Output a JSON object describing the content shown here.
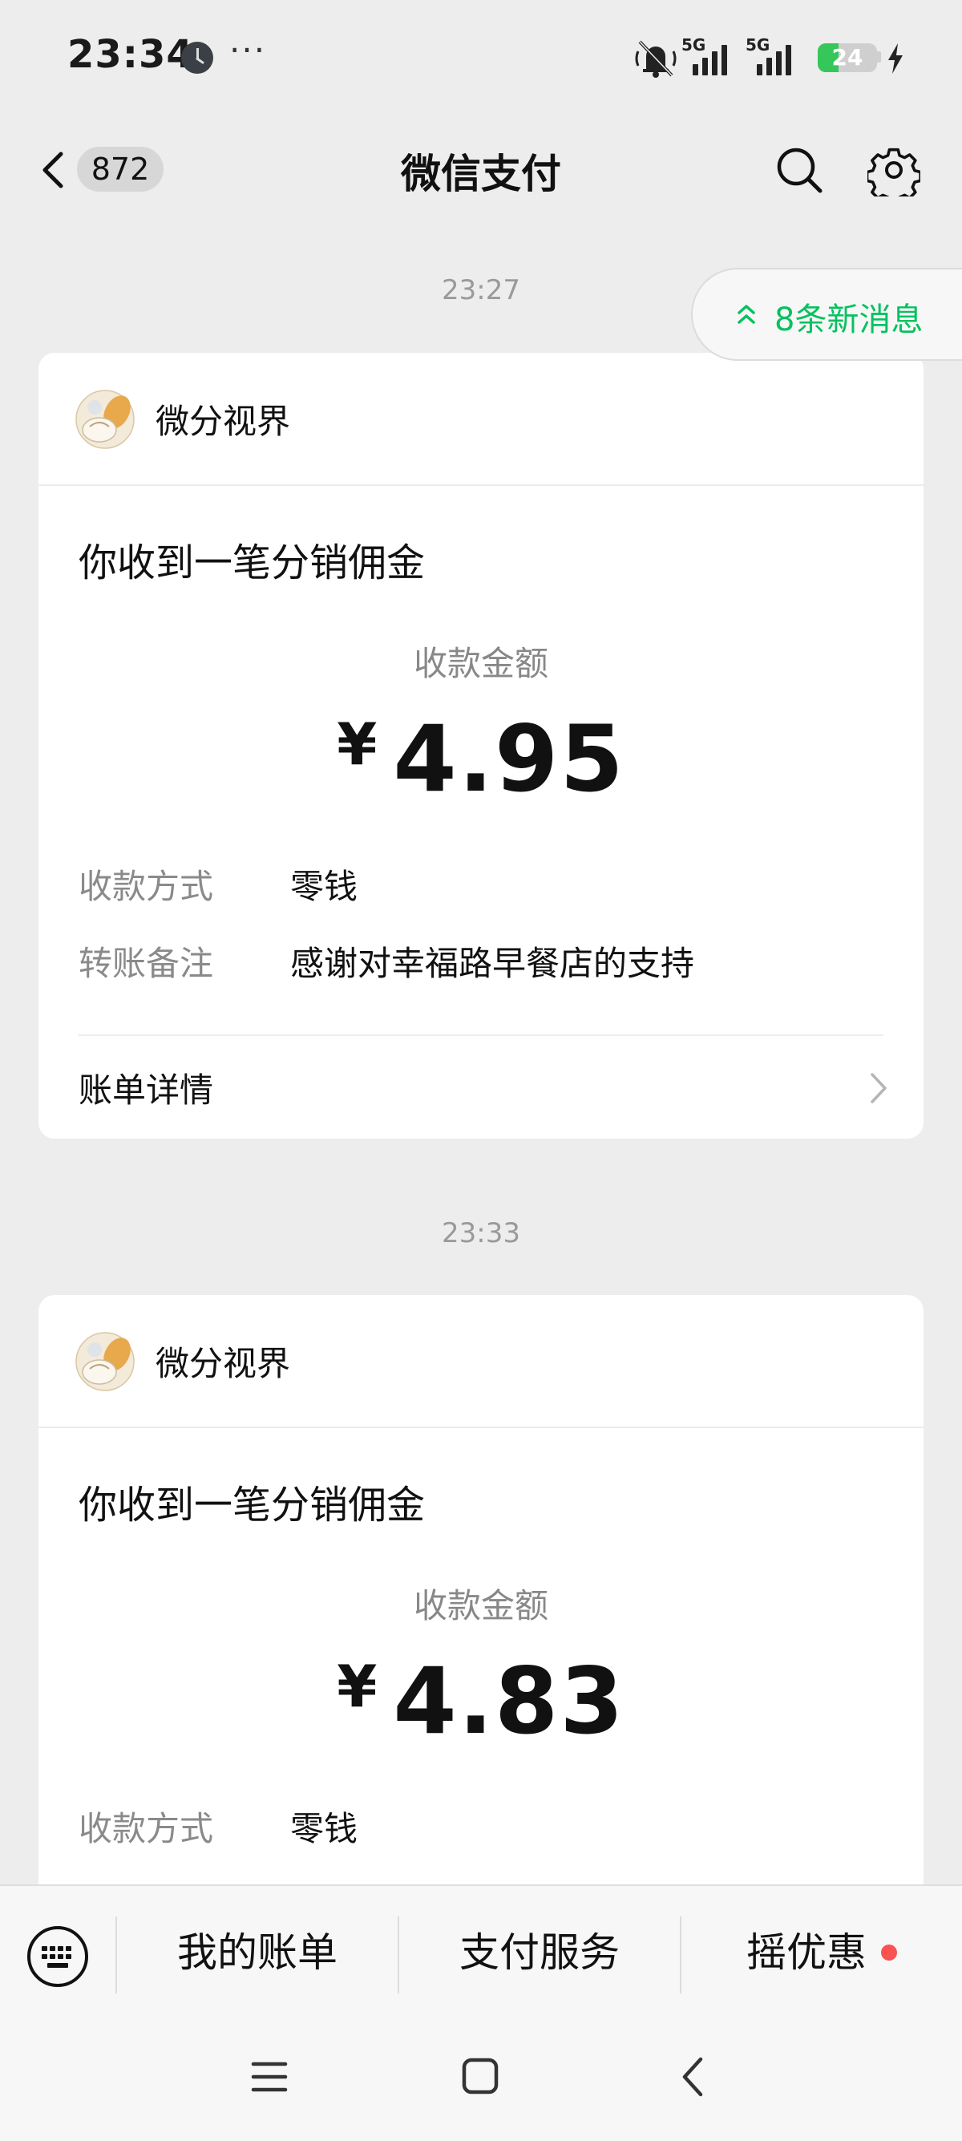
{
  "status_bar": {
    "time": "23:34",
    "more": "···",
    "network_1": "5G",
    "network_2": "5G",
    "battery_level": "24",
    "battery_fraction": 0.24,
    "icons": [
      "clock-icon",
      "mute-vibrate-icon",
      "signal-icon",
      "charging-icon"
    ]
  },
  "header": {
    "back_count": "872",
    "title": "微信支付"
  },
  "new_messages": {
    "label": "8条新消息",
    "color": "#07c160"
  },
  "messages": [
    {
      "time": "23:27",
      "sender": "微分视界",
      "subject": "你收到一笔分销佣金",
      "amount_label": "收款金额",
      "currency": "¥",
      "amount": "4.95",
      "details": [
        {
          "label": "收款方式",
          "value": "零钱"
        },
        {
          "label": "转账备注",
          "value": "感谢对幸福路早餐店的支持"
        }
      ],
      "link_label": "账单详情"
    },
    {
      "time": "23:33",
      "sender": "微分视界",
      "subject": "你收到一笔分销佣金",
      "amount_label": "收款金额",
      "currency": "¥",
      "amount": "4.83",
      "details": [
        {
          "label": "收款方式",
          "value": "零钱"
        }
      ]
    }
  ],
  "bottom_menu": {
    "items": [
      {
        "label": "我的账单"
      },
      {
        "label": "支付服务"
      },
      {
        "label": "摇优惠",
        "has_dot": true
      }
    ],
    "dot_color": "#fa5151"
  },
  "nav_bar": {
    "icons": [
      "menu-icon",
      "home-icon",
      "back-icon"
    ]
  }
}
